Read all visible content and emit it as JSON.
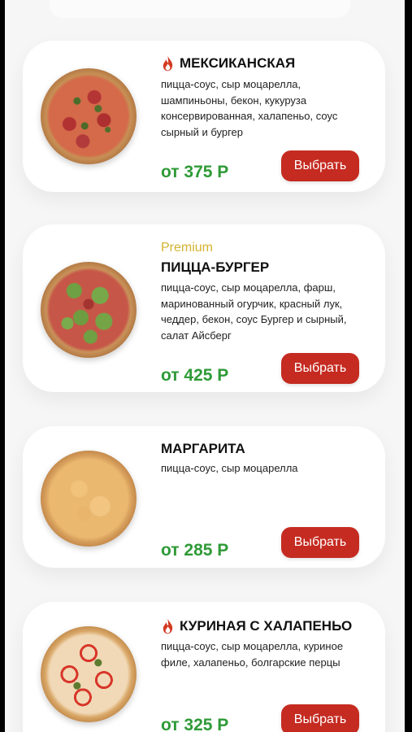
{
  "products": [
    {
      "badge": "",
      "spicy": true,
      "name": "МЕКСИКАНСКАЯ",
      "description": "пицца-соус, сыр моцарелла, шампиньоны, бекон, кукуруза консервированная, халапеньо, соус сырный и бургер",
      "price": "от 375 Р",
      "button": "Выбрать"
    },
    {
      "badge": "Premium",
      "spicy": false,
      "name": "ПИЦЦА-БУРГЕР",
      "description": "пицца-соус, сыр моцарелла, фарш, маринованный огурчик, красный лук, чеддер, бекон, соус Бургер и сырный, салат Айсберг",
      "price": "от 425 Р",
      "button": "Выбрать"
    },
    {
      "badge": "",
      "spicy": false,
      "name": "МАРГАРИТА",
      "description": "пицца-соус, сыр моцарелла",
      "price": "от 285 Р",
      "button": "Выбрать"
    },
    {
      "badge": "",
      "spicy": true,
      "name": "КУРИНАЯ С ХАЛАПЕНЬО",
      "description": "пицца-соус, сыр моцарелла, куриное филе, халапеньо, болгарские перцы",
      "price": "от 325 Р",
      "button": "Выбрать"
    }
  ],
  "icons": {
    "spicy": "fire-icon"
  },
  "colors": {
    "price": "#2f9a37",
    "button": "#c52b21",
    "premium": "#d4b230",
    "fire": "#d33a22"
  }
}
